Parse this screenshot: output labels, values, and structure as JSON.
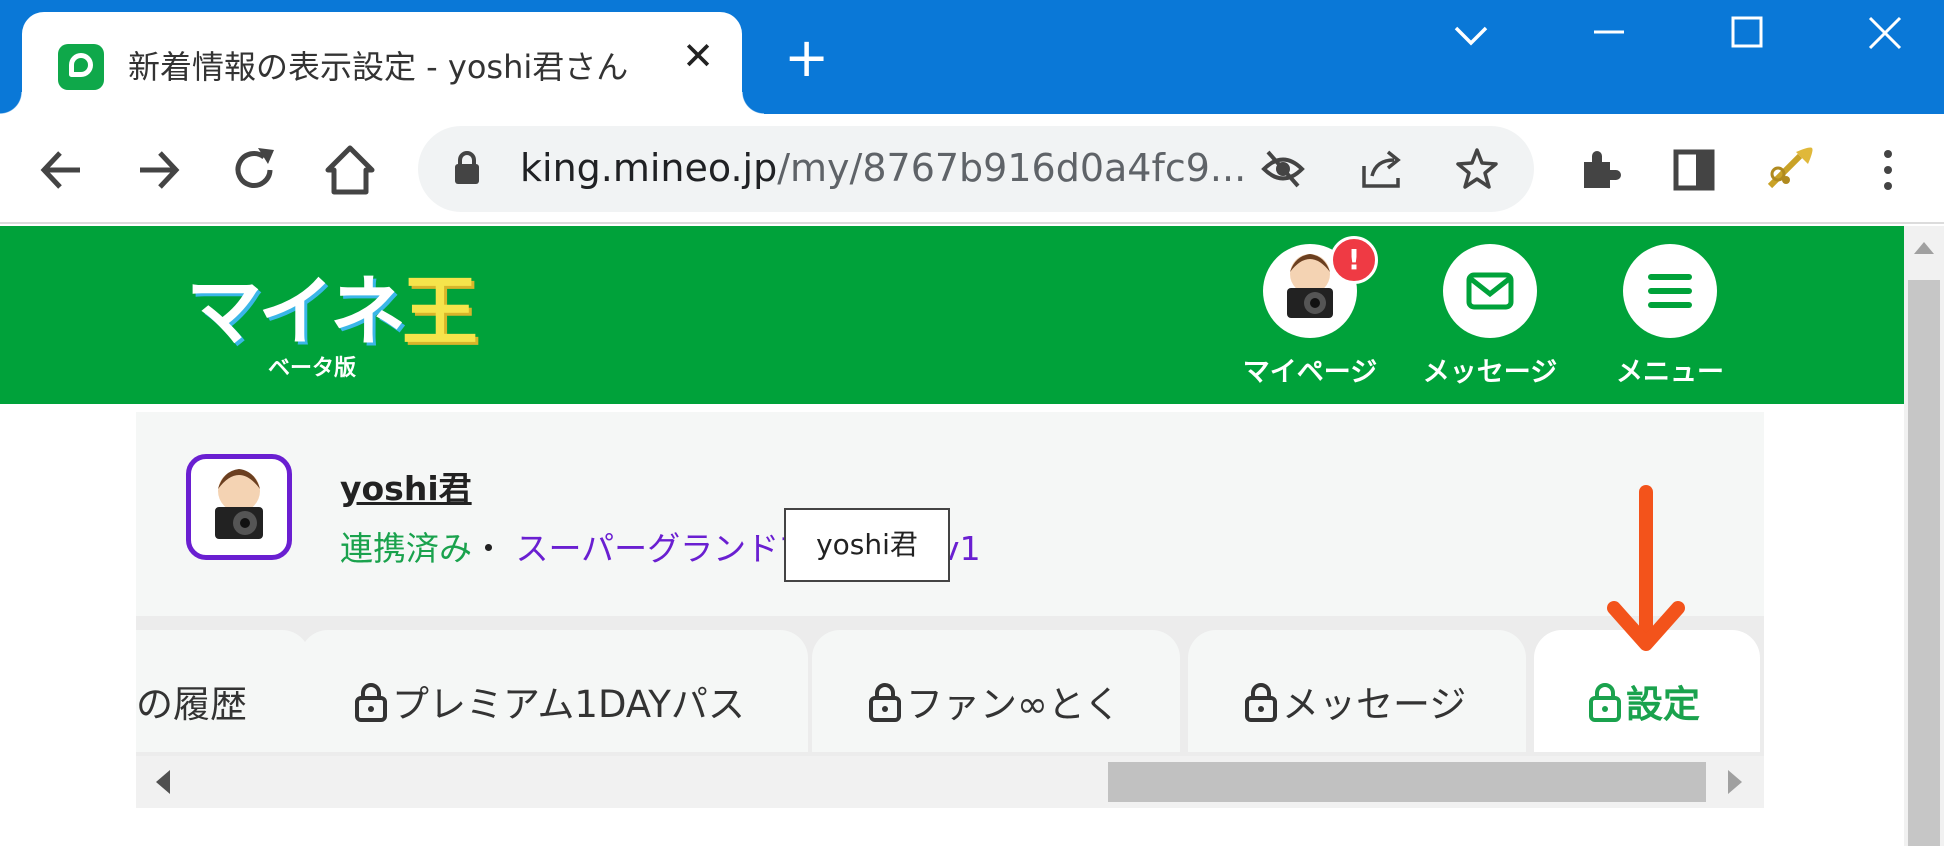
{
  "browser": {
    "tab_title": "新着情報の表示設定 - yoshi君さん",
    "close_glyph": "✕",
    "new_tab_glyph": "+",
    "url_host": "king.mineo.jp",
    "url_path": "/my/8767b916d0a4fc9..."
  },
  "site": {
    "logo_text": "マイネ",
    "logo_kun": "王",
    "logo_sub": "ベータ版",
    "nav": {
      "mypage_label": "マイページ",
      "mypage_badge": "!",
      "message_label": "メッセージ",
      "menu_label": "メニュー"
    }
  },
  "profile": {
    "name": "yoshi君",
    "linked": "連携済み",
    "separator": "・",
    "rank": "スーパーグランドマスター Lv1",
    "tooltip": "yoshi君"
  },
  "tabs": [
    {
      "label": "の履歴",
      "locked": false
    },
    {
      "label": "プレミアム1DAYパス",
      "locked": true
    },
    {
      "label": "ファン∞とく",
      "locked": true
    },
    {
      "label": "メッセージ",
      "locked": true
    },
    {
      "label": "設定",
      "locked": true,
      "active": true
    }
  ],
  "colors": {
    "chrome_blue": "#0a78d7",
    "brand_green": "#00a23a",
    "accent_purple": "#6a1fd1",
    "arrow_orange": "#f3531b"
  }
}
